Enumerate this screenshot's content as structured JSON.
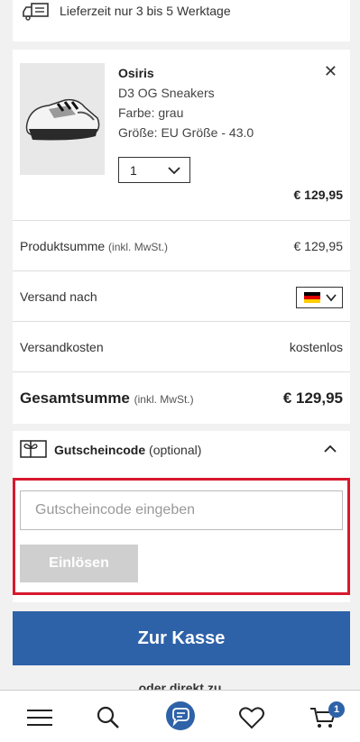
{
  "delivery": {
    "text": "Lieferzeit nur 3 bis 5 Werktage",
    "icon": "delivery-truck-icon"
  },
  "product": {
    "brand": "Osiris",
    "name": "D3 OG Sneakers",
    "color": "Farbe: grau",
    "size": "Größe: EU Größe - 43.0",
    "quantity": "1",
    "price": "€ 129,95",
    "image": "sneaker-image"
  },
  "summary": {
    "subtotal_label": "Produktsumme",
    "subtotal_note": "(inkl. MwSt.)",
    "subtotal_value": "€ 129,95",
    "shipping_to_label": "Versand nach",
    "shipping_country": "Deutschland-flag",
    "shipping_cost_label": "Versandkosten",
    "shipping_cost_value": "kostenlos",
    "total_label": "Gesamtsumme",
    "total_note": "(inkl. MwSt.)",
    "total_value": "€ 129,95"
  },
  "voucher": {
    "title": "Gutscheincode",
    "optional": "(optional)",
    "placeholder": "Gutscheincode eingeben",
    "redeem_label": "Einlösen"
  },
  "checkout": {
    "label": "Zur Kasse",
    "alt_text": "oder direkt zu"
  },
  "nav": {
    "items": [
      "menu-icon",
      "search-icon",
      "chat-icon",
      "heart-icon",
      "cart-icon"
    ],
    "cart_count": "1"
  },
  "colors": {
    "accent": "#2e62a8",
    "highlight": "#d7192d",
    "disabled": "#cfcfcf"
  }
}
